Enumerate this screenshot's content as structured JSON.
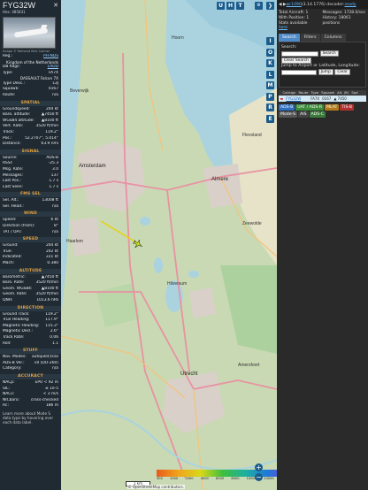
{
  "aircraft": {
    "callsign": "FYG32W",
    "hex": "Hex: 485831",
    "photo_credit": "Image © Remond Bert Caimer",
    "info_rows": [
      {
        "k": "Reg.:",
        "v": "PH-NDS",
        "link": true
      },
      {
        "k": "",
        "v": "Kingdom of the Netherlands",
        "wrap": true
      },
      {
        "k": "DB flags:",
        "v": "LADD",
        "link": true
      },
      {
        "k": "Type:",
        "v": "FA7X"
      },
      {
        "k": "",
        "v": "DASSAULT Falcon 7X",
        "wrap": true
      },
      {
        "k": "Type Desc.:",
        "v": "L3J"
      },
      {
        "k": "Squawk:",
        "v": "0167"
      },
      {
        "k": "Route:",
        "v": "n/a"
      }
    ],
    "sections": [
      {
        "title": "SPATIAL",
        "rows": [
          {
            "k": "Groundspeed:",
            "v": "244 kt"
          },
          {
            "k": "Baro. altitude:",
            "v": "▲7450 ft"
          },
          {
            "k": "WGS84 altitude:",
            "v": "▲8100 ft"
          },
          {
            "k": "Vert. Rate:",
            "v": "3520 ft/min"
          },
          {
            "k": "Track:",
            "v": "119.2°"
          },
          {
            "k": "Pos.:",
            "v": "52.2707°, 5.014°"
          },
          {
            "k": "Distance:",
            "v": "63.9 nmi"
          }
        ]
      },
      {
        "title": "SIGNAL",
        "rows": [
          {
            "k": "Source:",
            "v": "ADS-B"
          },
          {
            "k": "RSSI:",
            "v": "-25.3"
          },
          {
            "k": "Msg. Rate:",
            "v": "3.0"
          },
          {
            "k": "Messages:",
            "v": "137"
          },
          {
            "k": "Last Pos.:",
            "v": "1.7 s"
          },
          {
            "k": "Last Seen:",
            "v": "1.7 s"
          }
        ]
      },
      {
        "title": "FMS SEL",
        "rows": [
          {
            "k": "Sel. Alt.:",
            "v": "13008 ft"
          },
          {
            "k": "Sel. Head.:",
            "v": "n/a"
          }
        ]
      },
      {
        "title": "WIND",
        "rows": [
          {
            "k": "Speed:",
            "v": "6 kt"
          },
          {
            "k": "Direction (from):",
            "v": "8°"
          },
          {
            "k": "TAT / OAT:",
            "v": "n/a"
          }
        ]
      },
      {
        "title": "SPEED",
        "rows": [
          {
            "k": "Ground:",
            "v": "244 kt"
          },
          {
            "k": "True:",
            "v": "242 kt"
          },
          {
            "k": "Indicated:",
            "v": "221 kt"
          },
          {
            "k": "Mach:",
            "v": "0.380"
          }
        ]
      },
      {
        "title": "ALTITUDE",
        "rows": [
          {
            "k": "Barometric:",
            "v": "▲7450 ft"
          },
          {
            "k": "Baro. Rate:",
            "v": "3520 ft/min"
          },
          {
            "k": "Geom. WGS84:",
            "v": "▲8100 ft"
          },
          {
            "k": "Geom. Rate:",
            "v": "3520 ft/min"
          },
          {
            "k": "QNH:",
            "v": "1013.6 hPa"
          }
        ]
      },
      {
        "title": "DIRECTION",
        "rows": [
          {
            "k": "Ground Track:",
            "v": "119.2°"
          },
          {
            "k": "True Heading:",
            "v": "117.9°"
          },
          {
            "k": "Magnetic Heading:",
            "v": "115.3°"
          },
          {
            "k": "Magnetic Decl.:",
            "v": "2.6°"
          },
          {
            "k": "Track Rate:",
            "v": "0.06"
          },
          {
            "k": "Roll:",
            "v": "1.1"
          }
        ]
      },
      {
        "title": "STUFF",
        "rows": [
          {
            "k": "Nav. Modes:",
            "v": "autopilot,tcas"
          },
          {
            "k": "ADS-B Ver.:",
            "v": "v0 (DO-260)"
          },
          {
            "k": "Category:",
            "v": "n/a"
          }
        ]
      },
      {
        "title": "ACCURACY",
        "rows": [
          {
            "k": "NACp:",
            "v": "EPU < 92 m"
          },
          {
            "k": "SIL:",
            "v": "≤ 1e-5"
          },
          {
            "k": "NACv:",
            "v": "< 3 m/s"
          },
          {
            "k": "NICbaro:",
            "v": "cross-checked"
          },
          {
            "k": "Rc:",
            "v": "186 m"
          }
        ]
      }
    ],
    "note": "Learn more about Mode S data type by hovering over each data label."
  },
  "map": {
    "buttons_top": [
      "U",
      "H",
      "T"
    ],
    "right_buttons": [
      "I",
      "O",
      "K",
      "L",
      "M",
      "P",
      "R",
      "E"
    ],
    "labels": [
      {
        "t": "Beverwijk",
        "c": "mlabel"
      },
      {
        "t": "Hoorn",
        "c": "mlabel"
      },
      {
        "t": "Amsterdam",
        "c": "mlabel big"
      },
      {
        "t": "Haarlem",
        "c": "mlabel"
      },
      {
        "t": "Almere",
        "c": "mlabel big"
      },
      {
        "t": "Hilversum",
        "c": "mlabel"
      },
      {
        "t": "Utrecht",
        "c": "mlabel big"
      },
      {
        "t": "Amersfoort",
        "c": "mlabel"
      },
      {
        "t": "Flevoland",
        "c": "mlabel"
      },
      {
        "t": "Zeewolde",
        "c": "mlabel"
      }
    ],
    "scale": "1 km",
    "alt_labels": [
      "300",
      "1000",
      "2000",
      "4000",
      "6000",
      "8000",
      "10000",
      "20000",
      "30000",
      "40000+"
    ],
    "attribution": "© OpenStreetMap contributors."
  },
  "panel": {
    "title_prefix": "◀ ▶ ",
    "version_link": "wr1090",
    "title_rest": " (3.14.1776) decoder: ",
    "title_ready": "ready",
    "stats": {
      "total": "Total Aircraft: 1",
      "with_pos": "With Position: 1",
      "stats_avail": "Stats available",
      "stats_link": "here",
      "messages": "Messages: 1728.0/sec",
      "history": "History: 18061 positions"
    },
    "tabs": [
      "Search",
      "Filters",
      "Columns"
    ],
    "search_label": "Search:",
    "search_button": "Search",
    "clear_search": "Clear Search",
    "jump_label": "Jump to Airport or Latitude, Longitude:",
    "jump_button": "Jump",
    "clear_button": "Clear",
    "table_headers": [
      "",
      "Callsign",
      "Route",
      "Type",
      "Squawk",
      "Alt. (ft)",
      "Spd"
    ],
    "table_row": {
      "flag": "▬",
      "callsign": "FYG32W",
      "route": "",
      "type": "FA7X",
      "squawk": "0167",
      "alt": "▲ 7450",
      "spd": ""
    },
    "sources": [
      {
        "t": "ADS-B",
        "color": "#2f6fbf"
      },
      {
        "t": "UAT / ADS-R",
        "color": "#3a8a3a"
      },
      {
        "t": "MLAT",
        "color": "#b07a1a"
      },
      {
        "t": "TIS-B",
        "color": "#b03030"
      },
      {
        "t": "Mode-S",
        "color": "#555555"
      },
      {
        "t": "AIS",
        "color": "#444444"
      },
      {
        "t": "ADS-C",
        "color": "#3a7a3a"
      }
    ]
  }
}
